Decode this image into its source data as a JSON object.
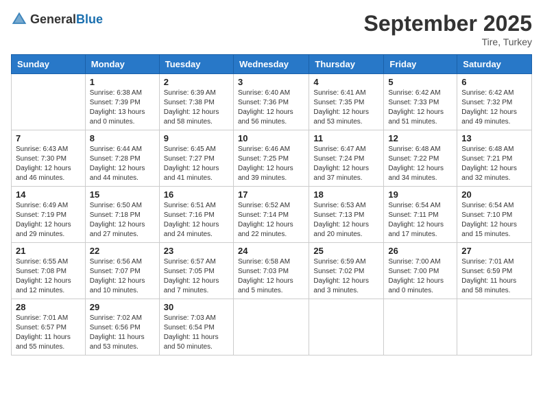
{
  "header": {
    "logo_general": "General",
    "logo_blue": "Blue",
    "month": "September 2025",
    "location": "Tire, Turkey"
  },
  "weekdays": [
    "Sunday",
    "Monday",
    "Tuesday",
    "Wednesday",
    "Thursday",
    "Friday",
    "Saturday"
  ],
  "weeks": [
    [
      {
        "day": "",
        "sunrise": "",
        "sunset": "",
        "daylight": ""
      },
      {
        "day": "1",
        "sunrise": "Sunrise: 6:38 AM",
        "sunset": "Sunset: 7:39 PM",
        "daylight": "Daylight: 13 hours and 0 minutes."
      },
      {
        "day": "2",
        "sunrise": "Sunrise: 6:39 AM",
        "sunset": "Sunset: 7:38 PM",
        "daylight": "Daylight: 12 hours and 58 minutes."
      },
      {
        "day": "3",
        "sunrise": "Sunrise: 6:40 AM",
        "sunset": "Sunset: 7:36 PM",
        "daylight": "Daylight: 12 hours and 56 minutes."
      },
      {
        "day": "4",
        "sunrise": "Sunrise: 6:41 AM",
        "sunset": "Sunset: 7:35 PM",
        "daylight": "Daylight: 12 hours and 53 minutes."
      },
      {
        "day": "5",
        "sunrise": "Sunrise: 6:42 AM",
        "sunset": "Sunset: 7:33 PM",
        "daylight": "Daylight: 12 hours and 51 minutes."
      },
      {
        "day": "6",
        "sunrise": "Sunrise: 6:42 AM",
        "sunset": "Sunset: 7:32 PM",
        "daylight": "Daylight: 12 hours and 49 minutes."
      }
    ],
    [
      {
        "day": "7",
        "sunrise": "Sunrise: 6:43 AM",
        "sunset": "Sunset: 7:30 PM",
        "daylight": "Daylight: 12 hours and 46 minutes."
      },
      {
        "day": "8",
        "sunrise": "Sunrise: 6:44 AM",
        "sunset": "Sunset: 7:28 PM",
        "daylight": "Daylight: 12 hours and 44 minutes."
      },
      {
        "day": "9",
        "sunrise": "Sunrise: 6:45 AM",
        "sunset": "Sunset: 7:27 PM",
        "daylight": "Daylight: 12 hours and 41 minutes."
      },
      {
        "day": "10",
        "sunrise": "Sunrise: 6:46 AM",
        "sunset": "Sunset: 7:25 PM",
        "daylight": "Daylight: 12 hours and 39 minutes."
      },
      {
        "day": "11",
        "sunrise": "Sunrise: 6:47 AM",
        "sunset": "Sunset: 7:24 PM",
        "daylight": "Daylight: 12 hours and 37 minutes."
      },
      {
        "day": "12",
        "sunrise": "Sunrise: 6:48 AM",
        "sunset": "Sunset: 7:22 PM",
        "daylight": "Daylight: 12 hours and 34 minutes."
      },
      {
        "day": "13",
        "sunrise": "Sunrise: 6:48 AM",
        "sunset": "Sunset: 7:21 PM",
        "daylight": "Daylight: 12 hours and 32 minutes."
      }
    ],
    [
      {
        "day": "14",
        "sunrise": "Sunrise: 6:49 AM",
        "sunset": "Sunset: 7:19 PM",
        "daylight": "Daylight: 12 hours and 29 minutes."
      },
      {
        "day": "15",
        "sunrise": "Sunrise: 6:50 AM",
        "sunset": "Sunset: 7:18 PM",
        "daylight": "Daylight: 12 hours and 27 minutes."
      },
      {
        "day": "16",
        "sunrise": "Sunrise: 6:51 AM",
        "sunset": "Sunset: 7:16 PM",
        "daylight": "Daylight: 12 hours and 24 minutes."
      },
      {
        "day": "17",
        "sunrise": "Sunrise: 6:52 AM",
        "sunset": "Sunset: 7:14 PM",
        "daylight": "Daylight: 12 hours and 22 minutes."
      },
      {
        "day": "18",
        "sunrise": "Sunrise: 6:53 AM",
        "sunset": "Sunset: 7:13 PM",
        "daylight": "Daylight: 12 hours and 20 minutes."
      },
      {
        "day": "19",
        "sunrise": "Sunrise: 6:54 AM",
        "sunset": "Sunset: 7:11 PM",
        "daylight": "Daylight: 12 hours and 17 minutes."
      },
      {
        "day": "20",
        "sunrise": "Sunrise: 6:54 AM",
        "sunset": "Sunset: 7:10 PM",
        "daylight": "Daylight: 12 hours and 15 minutes."
      }
    ],
    [
      {
        "day": "21",
        "sunrise": "Sunrise: 6:55 AM",
        "sunset": "Sunset: 7:08 PM",
        "daylight": "Daylight: 12 hours and 12 minutes."
      },
      {
        "day": "22",
        "sunrise": "Sunrise: 6:56 AM",
        "sunset": "Sunset: 7:07 PM",
        "daylight": "Daylight: 12 hours and 10 minutes."
      },
      {
        "day": "23",
        "sunrise": "Sunrise: 6:57 AM",
        "sunset": "Sunset: 7:05 PM",
        "daylight": "Daylight: 12 hours and 7 minutes."
      },
      {
        "day": "24",
        "sunrise": "Sunrise: 6:58 AM",
        "sunset": "Sunset: 7:03 PM",
        "daylight": "Daylight: 12 hours and 5 minutes."
      },
      {
        "day": "25",
        "sunrise": "Sunrise: 6:59 AM",
        "sunset": "Sunset: 7:02 PM",
        "daylight": "Daylight: 12 hours and 3 minutes."
      },
      {
        "day": "26",
        "sunrise": "Sunrise: 7:00 AM",
        "sunset": "Sunset: 7:00 PM",
        "daylight": "Daylight: 12 hours and 0 minutes."
      },
      {
        "day": "27",
        "sunrise": "Sunrise: 7:01 AM",
        "sunset": "Sunset: 6:59 PM",
        "daylight": "Daylight: 11 hours and 58 minutes."
      }
    ],
    [
      {
        "day": "28",
        "sunrise": "Sunrise: 7:01 AM",
        "sunset": "Sunset: 6:57 PM",
        "daylight": "Daylight: 11 hours and 55 minutes."
      },
      {
        "day": "29",
        "sunrise": "Sunrise: 7:02 AM",
        "sunset": "Sunset: 6:56 PM",
        "daylight": "Daylight: 11 hours and 53 minutes."
      },
      {
        "day": "30",
        "sunrise": "Sunrise: 7:03 AM",
        "sunset": "Sunset: 6:54 PM",
        "daylight": "Daylight: 11 hours and 50 minutes."
      },
      {
        "day": "",
        "sunrise": "",
        "sunset": "",
        "daylight": ""
      },
      {
        "day": "",
        "sunrise": "",
        "sunset": "",
        "daylight": ""
      },
      {
        "day": "",
        "sunrise": "",
        "sunset": "",
        "daylight": ""
      },
      {
        "day": "",
        "sunrise": "",
        "sunset": "",
        "daylight": ""
      }
    ]
  ]
}
